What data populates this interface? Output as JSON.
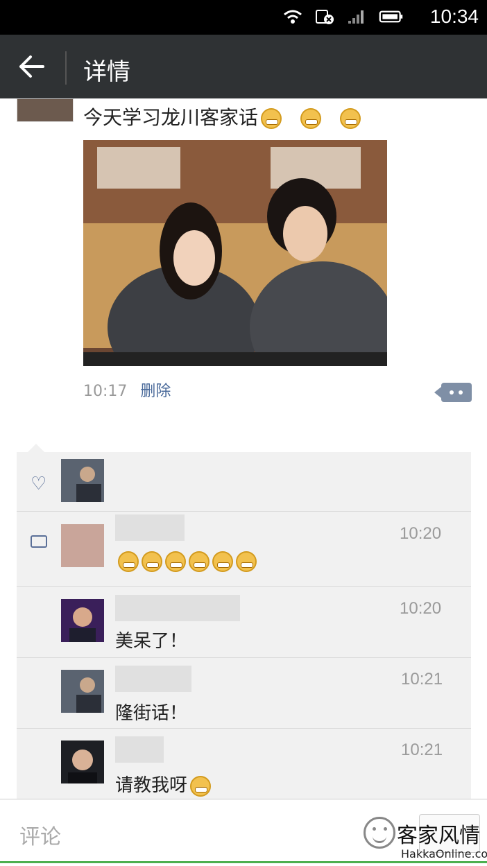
{
  "status_bar": {
    "time": "10:34",
    "icons": [
      "wifi-icon",
      "no-sim-icon",
      "signal-icon",
      "battery-icon"
    ]
  },
  "header": {
    "title": "详情",
    "back_icon": "arrow-left-icon"
  },
  "post": {
    "text": "今天学习龙川客家话",
    "emoji_count": 3,
    "photo_alt": "photo",
    "time": "10:17",
    "delete_label": "删除",
    "more_icon": "more-dots-icon"
  },
  "likes": {
    "icon": "heart-icon"
  },
  "comments": {
    "icon": "comment-icon",
    "items": [
      {
        "time": "10:20",
        "text": "",
        "emoji_count": 6
      },
      {
        "time": "10:20",
        "text": "美呆了！"
      },
      {
        "time": "10:21",
        "text": "隆街话！"
      },
      {
        "time": "10:21",
        "text": "请教我呀",
        "emoji_count": 1
      }
    ]
  },
  "input": {
    "placeholder": "评论",
    "emoji_icon": "smiley-icon"
  },
  "watermark": {
    "text": "客家风情",
    "url": "HakkaOnline.com"
  },
  "colors": {
    "topbar": "#2f3234",
    "link": "#4a6a9a",
    "panel": "#f1f1f1",
    "accent_icon": "#5a6f98"
  }
}
